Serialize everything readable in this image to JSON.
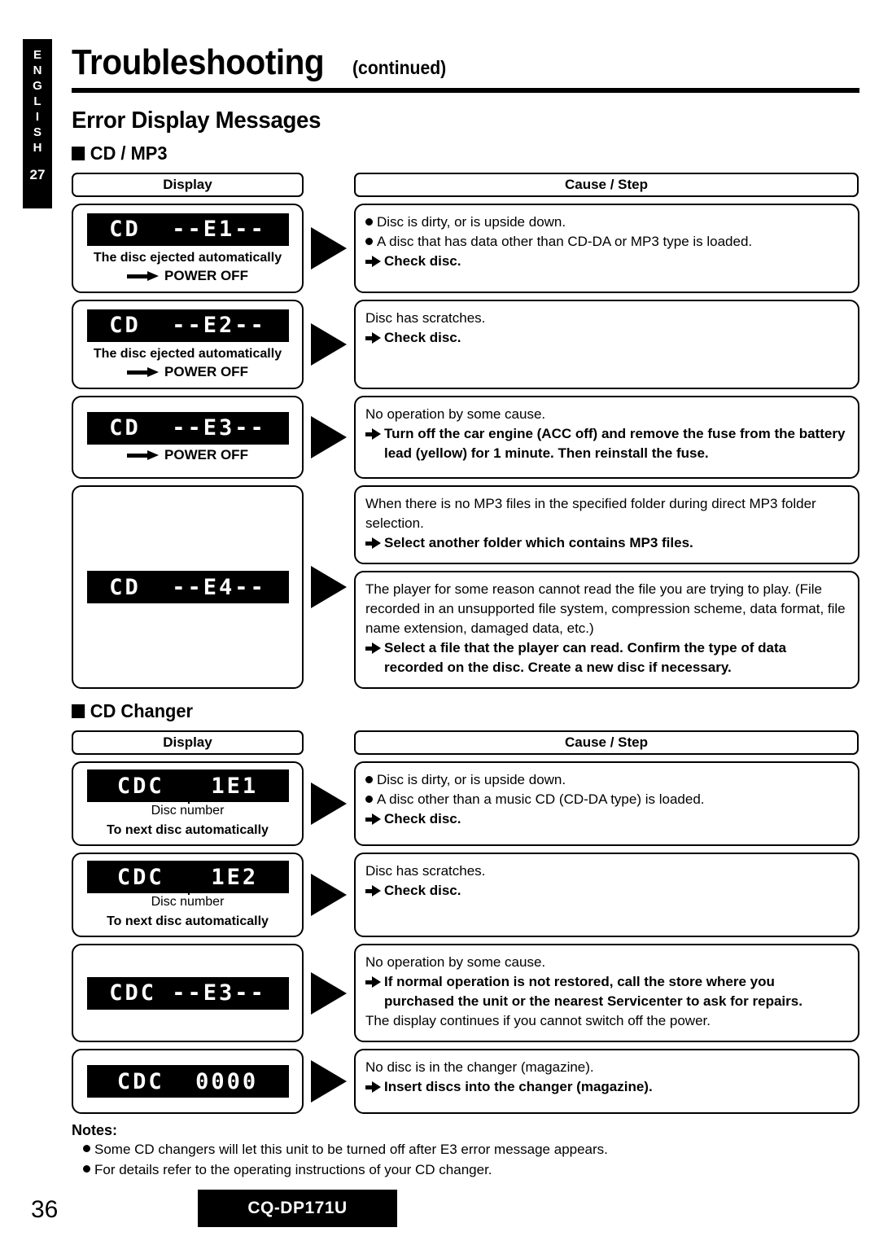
{
  "sidebar": {
    "language_letters": [
      "E",
      "N",
      "G",
      "L",
      "I",
      "S",
      "H"
    ],
    "section_number": "27"
  },
  "header": {
    "title": "Troubleshooting",
    "title_suffix": "(continued)",
    "heading": "Error Display Messages"
  },
  "cd_mp3": {
    "section_label": "CD / MP3",
    "col_display": "Display",
    "col_cause": "Cause / Step",
    "rows": [
      {
        "lcd": "CD  --E1--",
        "caption": "The disc ejected automatically",
        "power": "POWER OFF",
        "causes": [
          {
            "lines": [
              {
                "marker": "bullet",
                "text": "Disc is dirty, or is upside down.",
                "bold": false
              },
              {
                "marker": "bullet",
                "text": "A disc that has data other than CD-DA or MP3 type is loaded.",
                "bold": false
              },
              {
                "marker": "arrow",
                "text": "Check disc.",
                "bold": true
              }
            ]
          }
        ]
      },
      {
        "lcd": "CD  --E2--",
        "caption": "The disc ejected automatically",
        "power": "POWER OFF",
        "causes": [
          {
            "lines": [
              {
                "marker": "none",
                "text": "Disc has scratches.",
                "bold": false
              },
              {
                "marker": "arrow",
                "text": "Check disc.",
                "bold": true
              }
            ]
          }
        ]
      },
      {
        "lcd": "CD  --E3--",
        "caption": "",
        "power": "POWER OFF",
        "causes": [
          {
            "lines": [
              {
                "marker": "none",
                "text": "No operation by some cause.",
                "bold": false
              },
              {
                "marker": "arrow",
                "text": "Turn off the car engine (ACC off) and remove the fuse from the battery lead (yellow) for 1 minute. Then reinstall the fuse.",
                "bold": true
              }
            ]
          }
        ]
      },
      {
        "lcd": "CD  --E4--",
        "caption": "",
        "power": "",
        "causes": [
          {
            "lines": [
              {
                "marker": "none",
                "text": "When there is no MP3 files in the specified folder during direct MP3 folder selection.",
                "bold": false
              },
              {
                "marker": "arrow",
                "text": "Select another folder which contains MP3 files.",
                "bold": true
              }
            ]
          },
          {
            "lines": [
              {
                "marker": "none",
                "text": "The player for some reason cannot read the file you are trying to play.  (File recorded in an unsupported file system, compression scheme, data format, file name extension, damaged data, etc.)",
                "bold": false
              },
              {
                "marker": "arrow",
                "text": "Select a file that the player can read.  Confirm the type of data recorded on the disc.  Create a new disc if necessary.",
                "bold": true
              }
            ]
          }
        ]
      }
    ]
  },
  "cd_changer": {
    "section_label": "CD Changer",
    "col_display": "Display",
    "col_cause": "Cause / Step",
    "disc_number_label": "Disc number",
    "rows": [
      {
        "lcd": "CDC   1E1",
        "has_disc_number": true,
        "caption": "To next disc automatically",
        "causes": [
          {
            "lines": [
              {
                "marker": "bullet",
                "text": "Disc is dirty, or is upside down.",
                "bold": false
              },
              {
                "marker": "bullet",
                "text": "A disc other than a music CD (CD-DA type) is loaded.",
                "bold": false
              },
              {
                "marker": "arrow",
                "text": "Check disc.",
                "bold": true
              }
            ]
          }
        ]
      },
      {
        "lcd": "CDC   1E2",
        "has_disc_number": true,
        "caption": "To next disc automatically",
        "causes": [
          {
            "lines": [
              {
                "marker": "none",
                "text": "Disc has scratches.",
                "bold": false
              },
              {
                "marker": "arrow",
                "text": "Check disc.",
                "bold": true
              }
            ]
          }
        ]
      },
      {
        "lcd": "CDC --E3--",
        "has_disc_number": false,
        "caption": "",
        "causes": [
          {
            "lines": [
              {
                "marker": "none",
                "text": "No operation by some cause.",
                "bold": false
              },
              {
                "marker": "arrow",
                "text": "If normal operation is not restored, call the store where you purchased the unit or the nearest Servicenter to ask for repairs.",
                "bold": true
              },
              {
                "marker": "none",
                "text": "The display continues if you cannot switch off the power.",
                "bold": false
              }
            ]
          }
        ]
      },
      {
        "lcd": "CDC  0000",
        "has_disc_number": false,
        "caption": "",
        "causes": [
          {
            "lines": [
              {
                "marker": "none",
                "text": "No disc is in the changer (magazine).",
                "bold": false
              },
              {
                "marker": "arrow",
                "text": "Insert discs into the changer (magazine).",
                "bold": true
              }
            ]
          }
        ]
      }
    ]
  },
  "notes": {
    "title": "Notes:",
    "items": [
      "Some CD changers will let this unit to be turned off after E3 error message appears.",
      "For details refer to the operating instructions of your CD changer."
    ]
  },
  "footer": {
    "page_number": "36",
    "model": "CQ-DP171U"
  }
}
